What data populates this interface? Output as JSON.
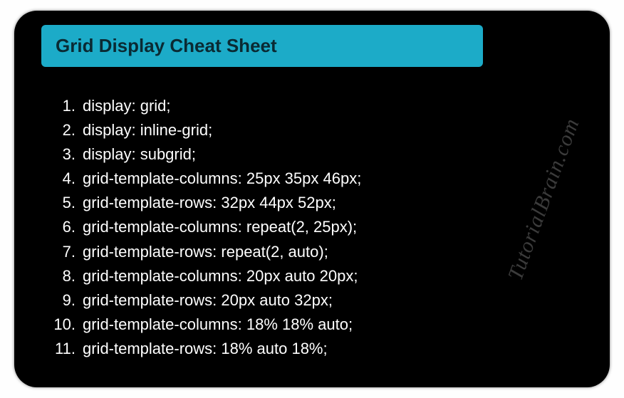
{
  "title": "Grid Display Cheat Sheet",
  "items": [
    "display: grid;",
    "display: inline-grid;",
    "display: subgrid;",
    "grid-template-columns: 25px 35px 46px;",
    "grid-template-rows: 32px 44px 52px;",
    "grid-template-columns: repeat(2, 25px);",
    "grid-template-rows: repeat(2, auto);",
    "grid-template-columns: 20px auto 20px;",
    "grid-template-rows: 20px auto 32px;",
    "grid-template-columns: 18% 18% auto;",
    "grid-template-rows: 18% auto 18%;"
  ],
  "watermark": "TutorialBrain.com",
  "colors": {
    "card_bg": "#000000",
    "title_bg": "#1cabc8",
    "title_fg": "#0a2a33",
    "text": "#ffffff",
    "watermark": "#3b3b3b"
  }
}
